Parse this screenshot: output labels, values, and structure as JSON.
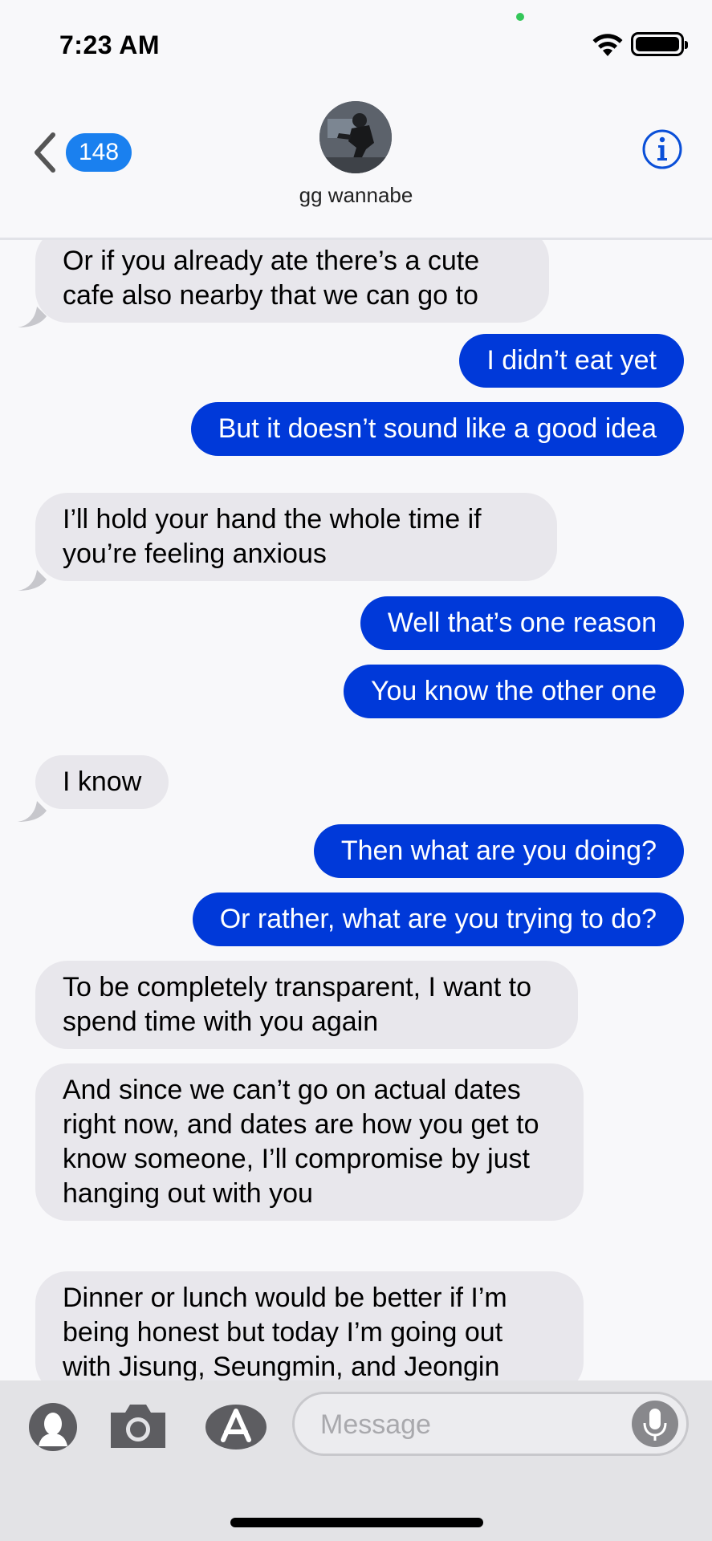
{
  "status_bar": {
    "time": "7:23 AM"
  },
  "header": {
    "back_badge": "148",
    "contact_name": "gg wannabe",
    "info_icon": "info-circle-icon"
  },
  "messages": [
    {
      "from": "them",
      "text": "Or if you already ate there’s a cute cafe also nearby that we can go to"
    },
    {
      "from": "me",
      "text": "I didn’t eat yet"
    },
    {
      "from": "me",
      "text": "But it doesn’t sound like a good idea"
    },
    {
      "from": "them",
      "text": "I’ll hold your hand the whole time if you’re feeling anxious"
    },
    {
      "from": "me",
      "text": "Well that’s one reason"
    },
    {
      "from": "me",
      "text": "You know the other one"
    },
    {
      "from": "them",
      "text": "I know"
    },
    {
      "from": "me",
      "text": "Then what are you doing?"
    },
    {
      "from": "me",
      "text": "Or rather, what are you trying to do?"
    },
    {
      "from": "them",
      "text": "To be completely transparent, I want to spend time with you again"
    },
    {
      "from": "them",
      "text": "And since we can’t go on actual dates right now, and dates are how you get to know someone, I’ll compromise by just hanging out with you"
    },
    {
      "from": "them",
      "text": "Dinner or lunch would be better if I’m being honest but today I’m going out with Jisung, Seungmin, and Jeongin"
    }
  ],
  "input_bar": {
    "placeholder": "Message"
  },
  "colors": {
    "outgoing_bubble": "#0039d9",
    "incoming_bubble": "#e8e7ec",
    "badge": "#1a80ef"
  }
}
